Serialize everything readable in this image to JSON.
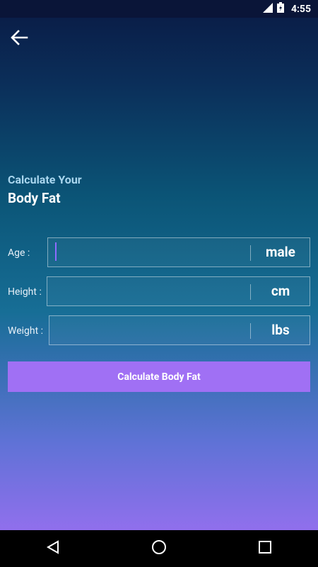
{
  "status_bar": {
    "time": "4:55"
  },
  "header": {
    "subtitle": "Calculate Your",
    "title": "Body Fat"
  },
  "form": {
    "age": {
      "label": "Age :",
      "value": "",
      "unit": "male"
    },
    "height": {
      "label": "Height :",
      "value": "",
      "unit": "cm"
    },
    "weight": {
      "label": "Weight :",
      "value": "",
      "unit": "lbs"
    }
  },
  "actions": {
    "calculate_label": "Calculate Body Fat"
  },
  "colors": {
    "accent": "#a070f4",
    "gradient_top": "#0a1a44",
    "gradient_bottom": "#a56ef6"
  }
}
